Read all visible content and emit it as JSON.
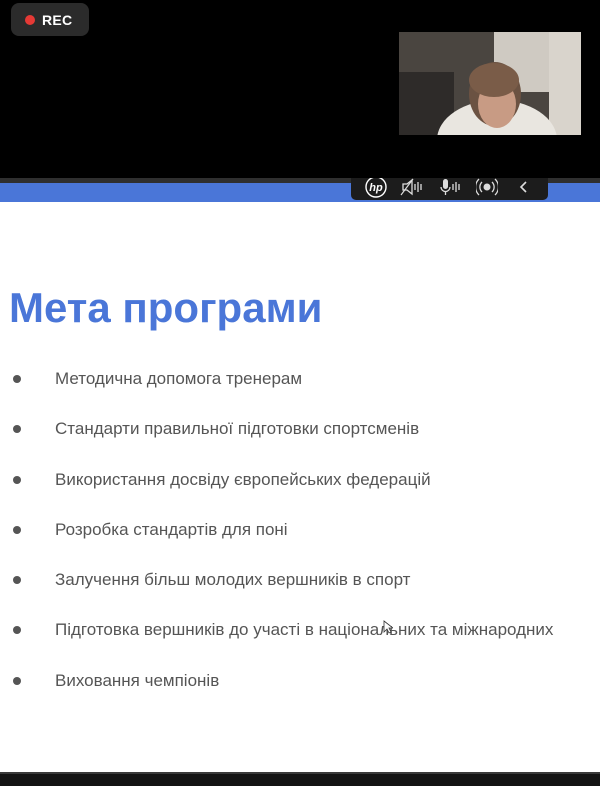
{
  "recording": {
    "label": "REC",
    "dot_color": "#e53935"
  },
  "video_feed": {
    "participant": "camera-feed"
  },
  "hp_toolbar": {
    "brand": "hp",
    "icons": [
      "hp-logo-icon",
      "speaker-mute-icon",
      "microphone-icon",
      "broadcast-icon",
      "chevron-left-icon"
    ]
  },
  "slide": {
    "accent_color": "#4a76d8",
    "title": "Мета програми",
    "bullets": [
      "Методична допомога тренерам",
      "Стандарти правильної підготовки спортсменів",
      "Використання досвіду європейських федерацій",
      "Розробка стандартів для поні",
      "Залучення більш молодих вершників в спорт",
      "Підготовка вершників до участі в національних та міжнародних",
      "Виховання чемпіонів"
    ]
  }
}
